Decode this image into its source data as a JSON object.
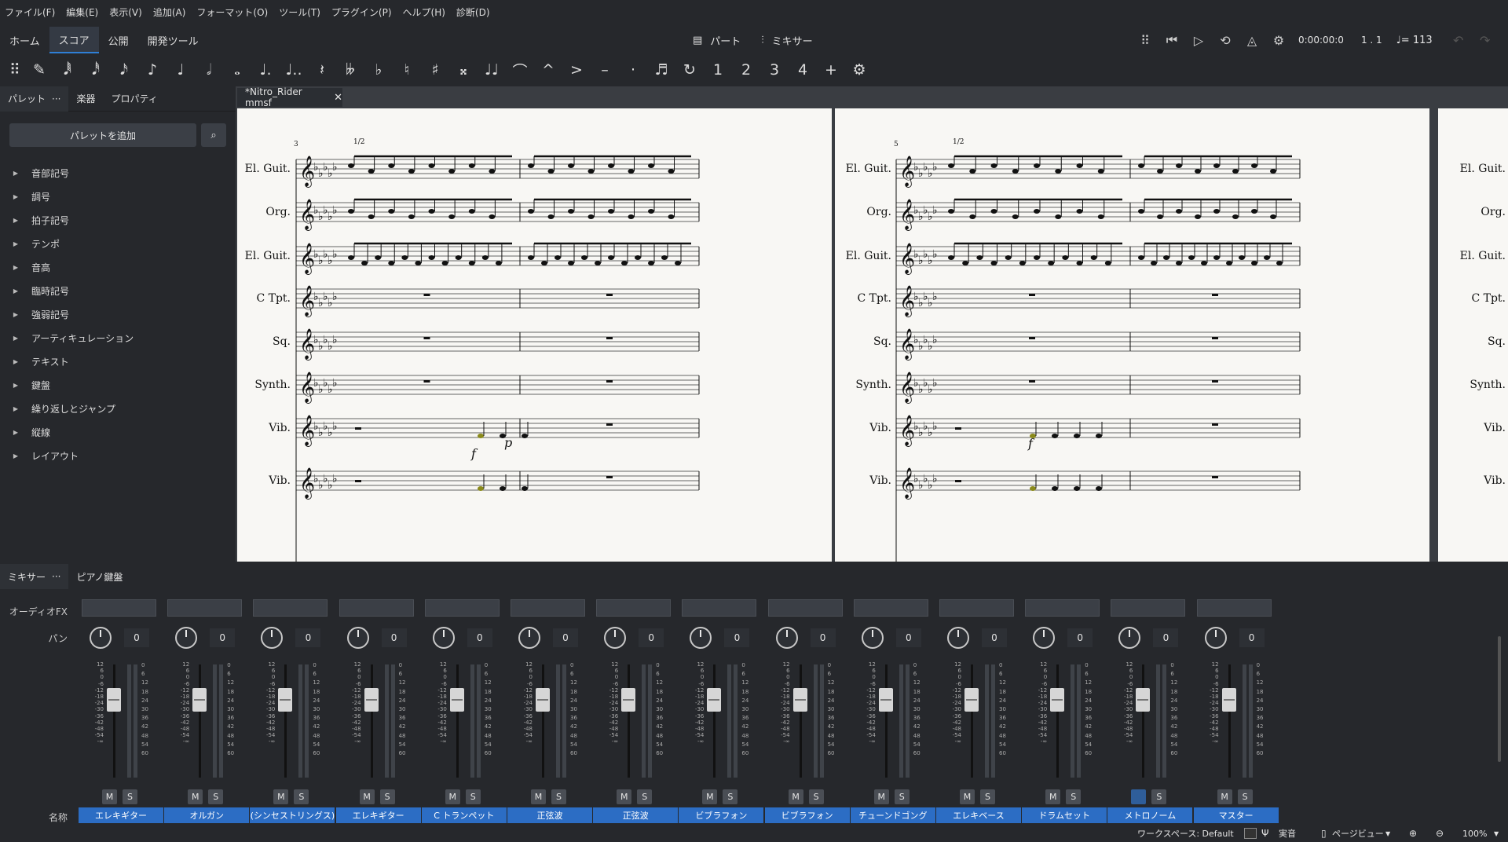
{
  "menu": [
    "ファイル(F)",
    "編集(E)",
    "表示(V)",
    "追加(A)",
    "フォーマット(O)",
    "ツール(T)",
    "プラグイン(P)",
    "ヘルプ(H)",
    "診断(D)"
  ],
  "nav": {
    "tabs": [
      "ホーム",
      "スコア",
      "公開",
      "開発ツール"
    ],
    "active_tab": "スコア",
    "parts_label": "パート",
    "mixer_label": "ミキサー",
    "time": "0:00:00:0",
    "position": "1 . 1",
    "tempo": "♩= 113"
  },
  "toolbar": {
    "icons": [
      "drag-handle-icon",
      "pen-icon",
      "64th-note-icon",
      "32nd-note-icon",
      "16th-note-icon",
      "eighth-note-icon",
      "quarter-note-icon",
      "half-note-icon",
      "whole-note-icon",
      "dot-icon",
      "double-dot-icon",
      "rest-icon",
      "double-flat-icon",
      "flat-icon",
      "natural-icon",
      "sharp-icon",
      "double-sharp-icon",
      "tie-icon",
      "slur-icon",
      "marcato-icon",
      "accent-icon",
      "tenuto-icon",
      "staccato-icon",
      "tuplet-icon",
      "flip-icon",
      "voice-1-icon",
      "voice-2-icon",
      "voice-3-icon",
      "voice-4-icon",
      "add-icon",
      "settings-icon"
    ],
    "glyphs": [
      "⠿",
      "✎",
      "𝅘𝅥𝅱",
      "𝅘𝅥𝅰",
      "𝅘𝅥𝅯",
      "♪",
      "♩",
      "𝅗𝅥",
      "𝅝",
      "♩.",
      "♩..",
      "𝄽",
      "𝄫",
      "♭",
      "♮",
      "♯",
      "𝄪",
      "♩♩",
      "⌒",
      "^",
      ">",
      "–",
      "·",
      "♬",
      "↻",
      "1",
      "2",
      "3",
      "4",
      "+",
      "⚙"
    ]
  },
  "left_panel": {
    "tabs": [
      "パレット",
      "楽器",
      "プロパティ"
    ],
    "tabs_more": "···",
    "add_palette": "パレットを追加",
    "items": [
      "音部記号",
      "調号",
      "拍子記号",
      "テンポ",
      "音高",
      "臨時記号",
      "強弱記号",
      "アーティキュレーション",
      "テキスト",
      "鍵盤",
      "繰り返しとジャンプ",
      "縦線",
      "レイアウト"
    ]
  },
  "score": {
    "tab_title": "*Nitro_Rider mmsf",
    "instruments": [
      "El. Guit.",
      "Org.",
      "El. Guit.",
      "C Tpt.",
      "Sq.",
      "Synth.",
      "Vib.",
      "Vib."
    ],
    "measure_numbers": [
      "3",
      "5"
    ],
    "annotations": [
      "1/2",
      "1/2"
    ],
    "dynamics": [
      "p",
      "f",
      "f"
    ]
  },
  "mixer": {
    "tabs": [
      "ミキサー",
      "ピアノ鍵盤"
    ],
    "tabs_more": "···",
    "row_labels": {
      "fx": "オーディオFX",
      "pan": "パン",
      "name": "名称"
    },
    "fader_scale": [
      "12",
      "6",
      "0",
      "-6",
      "-12",
      "-18",
      "-24",
      "-30",
      "-36",
      "-42",
      "-48",
      "-54",
      "-∞"
    ],
    "meter_scale": [
      "0",
      "6",
      "12",
      "18",
      "24",
      "30",
      "36",
      "42",
      "48",
      "54",
      "60"
    ],
    "channels": [
      {
        "name": "エレキギター",
        "pan": "0",
        "mute": "M",
        "solo": "S"
      },
      {
        "name": "オルガン",
        "pan": "0",
        "mute": "M",
        "solo": "S"
      },
      {
        "name": "(シンセストリングス)",
        "pan": "0",
        "mute": "M",
        "solo": "S"
      },
      {
        "name": "エレキギター",
        "pan": "0",
        "mute": "M",
        "solo": "S"
      },
      {
        "name": "C トランペット",
        "pan": "0",
        "mute": "M",
        "solo": "S"
      },
      {
        "name": "正弦波",
        "pan": "0",
        "mute": "M",
        "solo": "S"
      },
      {
        "name": "正弦波",
        "pan": "0",
        "mute": "M",
        "solo": "S"
      },
      {
        "name": "ビブラフォン",
        "pan": "0",
        "mute": "M",
        "solo": "S"
      },
      {
        "name": "ビブラフォン",
        "pan": "0",
        "mute": "M",
        "solo": "S"
      },
      {
        "name": "チューンドゴング",
        "pan": "0",
        "mute": "M",
        "solo": "S"
      },
      {
        "name": "エレキベース",
        "pan": "0",
        "mute": "M",
        "solo": "S"
      },
      {
        "name": "ドラムセット",
        "pan": "0",
        "mute": "M",
        "solo": "S"
      },
      {
        "name": "メトロノーム",
        "pan": "0",
        "mute": "M",
        "solo": "S",
        "muted": true
      },
      {
        "name": "マスター",
        "pan": "0",
        "mute": "M",
        "solo": "S"
      }
    ]
  },
  "status": {
    "workspace": "ワークスペース: Default",
    "concert_pitch": "実音",
    "view_mode": "ページビュー",
    "zoom": "100%"
  },
  "colors": {
    "accent": "#2c6dc4",
    "bg": "#26282c",
    "page": "#f8f7f4",
    "highlight_note": "#8a8a1a"
  }
}
